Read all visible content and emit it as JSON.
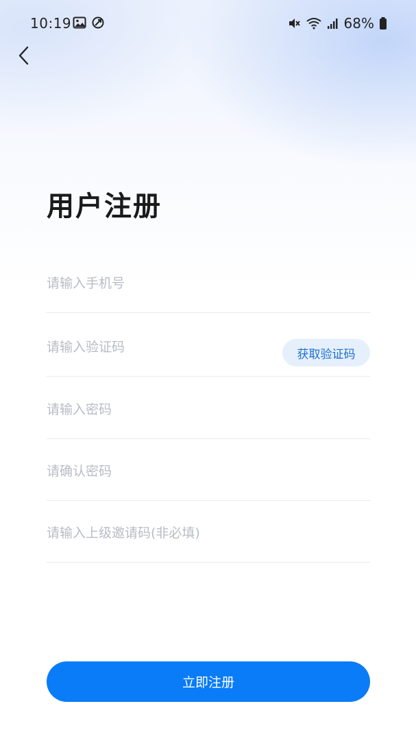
{
  "status_bar": {
    "time": "10:19",
    "battery": "68%",
    "icons": [
      "image-icon",
      "data-saver-icon",
      "mute-icon",
      "wifi-icon",
      "signal-icon",
      "battery-icon"
    ]
  },
  "header": {
    "back_icon": "chevron-left-icon"
  },
  "page": {
    "title": "用户注册"
  },
  "form": {
    "phone_placeholder": "请输入手机号",
    "code_placeholder": "请输入验证码",
    "get_code_label": "获取验证码",
    "password_placeholder": "请输入密码",
    "confirm_placeholder": "请确认密码",
    "invite_placeholder": "请输入上级邀请码(非必填)"
  },
  "actions": {
    "submit_label": "立即注册"
  },
  "colors": {
    "accent": "#0a7cf8",
    "code_button_bg": "#e6f0fc",
    "code_button_text": "#1f6fd0",
    "placeholder": "#b8bcc3"
  }
}
